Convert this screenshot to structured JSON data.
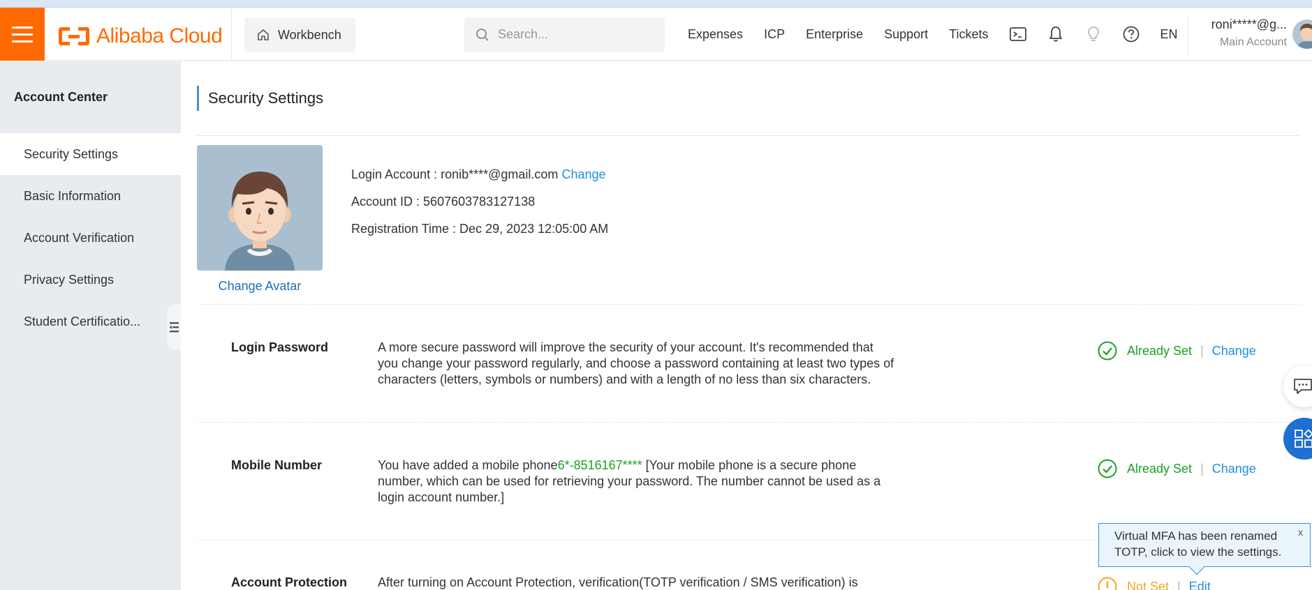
{
  "brand": {
    "name": "Alibaba Cloud",
    "accent": "#ff6a00",
    "link": "#1f8fdf",
    "success": "#1aa024",
    "warning": "#f5a623"
  },
  "header": {
    "workbench_label": "Workbench",
    "search_placeholder": "Search...",
    "nav": [
      "Expenses",
      "ICP",
      "Enterprise",
      "Support",
      "Tickets"
    ],
    "icons": [
      "terminal-icon",
      "bell-icon",
      "lightbulb-icon",
      "help-icon"
    ],
    "language": "EN",
    "account_user": "roni*****@g...",
    "account_role": "Main Account"
  },
  "sidebar": {
    "title": "Account Center",
    "items": [
      {
        "label": "Security Settings",
        "active": true
      },
      {
        "label": "Basic Information"
      },
      {
        "label": "Account Verification"
      },
      {
        "label": "Privacy Settings"
      },
      {
        "label": "Student Certificatio..."
      }
    ]
  },
  "main": {
    "title": "Security Settings",
    "change_avatar": "Change Avatar",
    "login_account_label": "Login Account : ",
    "login_account_value": "ronib****@gmail.com",
    "login_account_change": "Change",
    "account_id_text": "Account ID : 5607603783127138",
    "registration_text": "Registration Time : Dec 29, 2023 12:05:00 AM",
    "rows": [
      {
        "label": "Login Password",
        "desc": "A more secure password will improve the security of your account. It's recommended that you change your password regularly, and choose a password containing at least two types of characters (letters, symbols or numbers) and with a length of no less than six characters.",
        "status": "Already Set",
        "action": "Change"
      },
      {
        "label": "Mobile Number",
        "desc_prefix": "You have added a mobile phone",
        "desc_phone": "6*-8516167****",
        "desc_suffix": " [Your mobile phone is a secure phone number, which can be used for retrieving your password. The number cannot be used as a login account number.]",
        "status": "Already Set",
        "action": "Change"
      },
      {
        "label": "Account Protection",
        "desc": "After turning on Account Protection, verification(TOTP verification / SMS verification) is",
        "status": "Not Set",
        "action": "Edit"
      }
    ]
  },
  "tooltip": {
    "text": "Virtual MFA has been renamed TOTP, click to view the settings.",
    "close": "x"
  }
}
